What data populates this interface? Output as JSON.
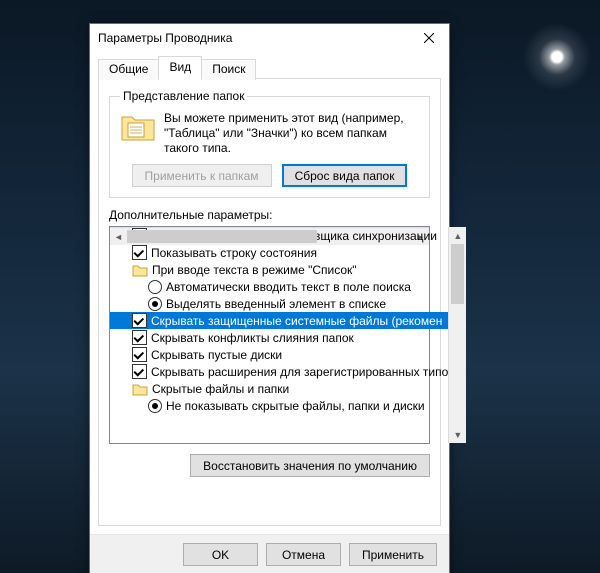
{
  "dialog": {
    "title": "Параметры Проводника",
    "tabs": {
      "general": "Общие",
      "view": "Вид",
      "search": "Поиск"
    }
  },
  "folder_views": {
    "legend": "Представление папок",
    "text": "Вы можете применить этот вид (например, \"Таблица\" или \"Значки\") ко всем папкам такого типа.",
    "apply": "Применить к папкам",
    "reset": "Сброс вида папок"
  },
  "advanced": {
    "label": "Дополнительные параметры:",
    "items": [
      {
        "kind": "check",
        "depth": 1,
        "checked": true,
        "label": "Показать уведомления поставщика синхронизации"
      },
      {
        "kind": "check",
        "depth": 1,
        "checked": true,
        "label": "Показывать строку состояния"
      },
      {
        "kind": "group",
        "depth": 1,
        "label": "При вводе текста в режиме \"Список\""
      },
      {
        "kind": "radio",
        "depth": 2,
        "checked": false,
        "label": "Автоматически вводить текст в поле поиска"
      },
      {
        "kind": "radio",
        "depth": 2,
        "checked": true,
        "label": "Выделять введенный элемент в списке"
      },
      {
        "kind": "check",
        "depth": 1,
        "checked": true,
        "selected": true,
        "label": "Скрывать защищенные системные файлы (рекомен"
      },
      {
        "kind": "check",
        "depth": 1,
        "checked": true,
        "label": "Скрывать конфликты слияния папок"
      },
      {
        "kind": "check",
        "depth": 1,
        "checked": true,
        "label": "Скрывать пустые диски"
      },
      {
        "kind": "check",
        "depth": 1,
        "checked": true,
        "label": "Скрывать расширения для зарегистрированных типо"
      },
      {
        "kind": "group",
        "depth": 1,
        "label": "Скрытые файлы и папки"
      },
      {
        "kind": "radio",
        "depth": 2,
        "checked": true,
        "label": "Не показывать скрытые файлы, папки и диски"
      }
    ],
    "restore": "Восстановить значения по умолчанию"
  },
  "buttons": {
    "ok": "OK",
    "cancel": "Отмена",
    "apply": "Применить"
  }
}
